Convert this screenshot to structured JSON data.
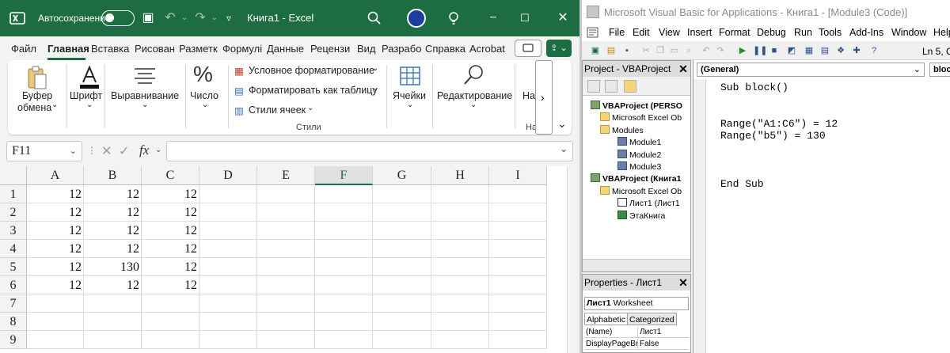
{
  "excel": {
    "autosave_label": "Автосохранение",
    "title": "Книга1  -  Excel",
    "tabs": [
      "Файл",
      "Главная",
      "Вставка",
      "Рисован",
      "Разметк",
      "Формулі",
      "Данные",
      "Рецензи",
      "Вид",
      "Разрабо",
      "Справка",
      "Acrobat"
    ],
    "active_tab": "Главная",
    "ribbon": {
      "clipboard_line1": "Буфер",
      "clipboard_line2": "обмена",
      "font": "Шрифт",
      "alignment": "Выравнивание",
      "number": "Число",
      "cond_format": "Условное форматирование",
      "format_table": "Форматировать как таблицу",
      "cell_styles": "Стили ячеек",
      "styles_caption": "Стили",
      "cells": "Ячейки",
      "editing": "Редактирование",
      "more_partial": "На",
      "more_partial_caption": "На",
      "scroll_right": "›",
      "collapse": "⌄"
    },
    "name_box": "F11",
    "fx_label": "fx",
    "columns": [
      "A",
      "B",
      "C",
      "D",
      "E",
      "F",
      "G",
      "H",
      "I"
    ],
    "selected_column": "F",
    "rows": [
      {
        "n": "1",
        "cells": [
          "12",
          "12",
          "12"
        ]
      },
      {
        "n": "2",
        "cells": [
          "12",
          "12",
          "12"
        ]
      },
      {
        "n": "3",
        "cells": [
          "12",
          "12",
          "12"
        ]
      },
      {
        "n": "4",
        "cells": [
          "12",
          "12",
          "12"
        ]
      },
      {
        "n": "5",
        "cells": [
          "12",
          "130",
          "12"
        ]
      },
      {
        "n": "6",
        "cells": [
          "12",
          "12",
          "12"
        ]
      },
      {
        "n": "7",
        "cells": [
          "",
          "",
          ""
        ]
      },
      {
        "n": "8",
        "cells": [
          "",
          "",
          ""
        ]
      },
      {
        "n": "9",
        "cells": [
          "",
          "",
          ""
        ]
      }
    ],
    "accent": "#1e6c41"
  },
  "vba": {
    "title": "Microsoft Visual Basic for Applications - Книга1 - [Module3 (Code)]",
    "menu": [
      "File",
      "Edit",
      "View",
      "Insert",
      "Format",
      "Debug",
      "Run",
      "Tools",
      "Add-Ins",
      "Window",
      "Help"
    ],
    "menu_partial_last": "Help",
    "status_ln": "Ln 5, C",
    "project_title": "Project - VBAProject",
    "tree": [
      {
        "label": "VBAProject (PERSO",
        "bold": true,
        "icon": "proj"
      },
      {
        "label": "Microsoft Excel Ob",
        "bold": false,
        "icon": "folder"
      },
      {
        "label": "Modules",
        "bold": false,
        "icon": "folder"
      },
      {
        "label": "Module1",
        "bold": false,
        "icon": "mod"
      },
      {
        "label": "Module2",
        "bold": false,
        "icon": "mod"
      },
      {
        "label": "Module3",
        "bold": false,
        "icon": "mod"
      },
      {
        "label": "VBAProject (Книга1",
        "bold": true,
        "icon": "proj"
      },
      {
        "label": "Microsoft Excel Ob",
        "bold": false,
        "icon": "folder"
      },
      {
        "label": "Лист1 (Лист1",
        "bold": false,
        "icon": "sheet"
      },
      {
        "label": "ЭтаКнига",
        "bold": false,
        "icon": "book"
      }
    ],
    "properties_title": "Properties - Лист1",
    "object_name": "Лист1",
    "object_type": "Worksheet",
    "prop_tabs": [
      "Alphabetic",
      "Categorized"
    ],
    "props": [
      {
        "name": "(Name)",
        "value": "Лист1"
      },
      {
        "name": "DisplayPageBre",
        "value": "False"
      }
    ],
    "general_dropdown": "(General)",
    "proc_dropdown": "block",
    "code_lines": "Sub block()\n\n\nRange(\"A1:C6\") = 12\nRange(\"b5\") = 130\n\n\n\nEnd Sub"
  }
}
